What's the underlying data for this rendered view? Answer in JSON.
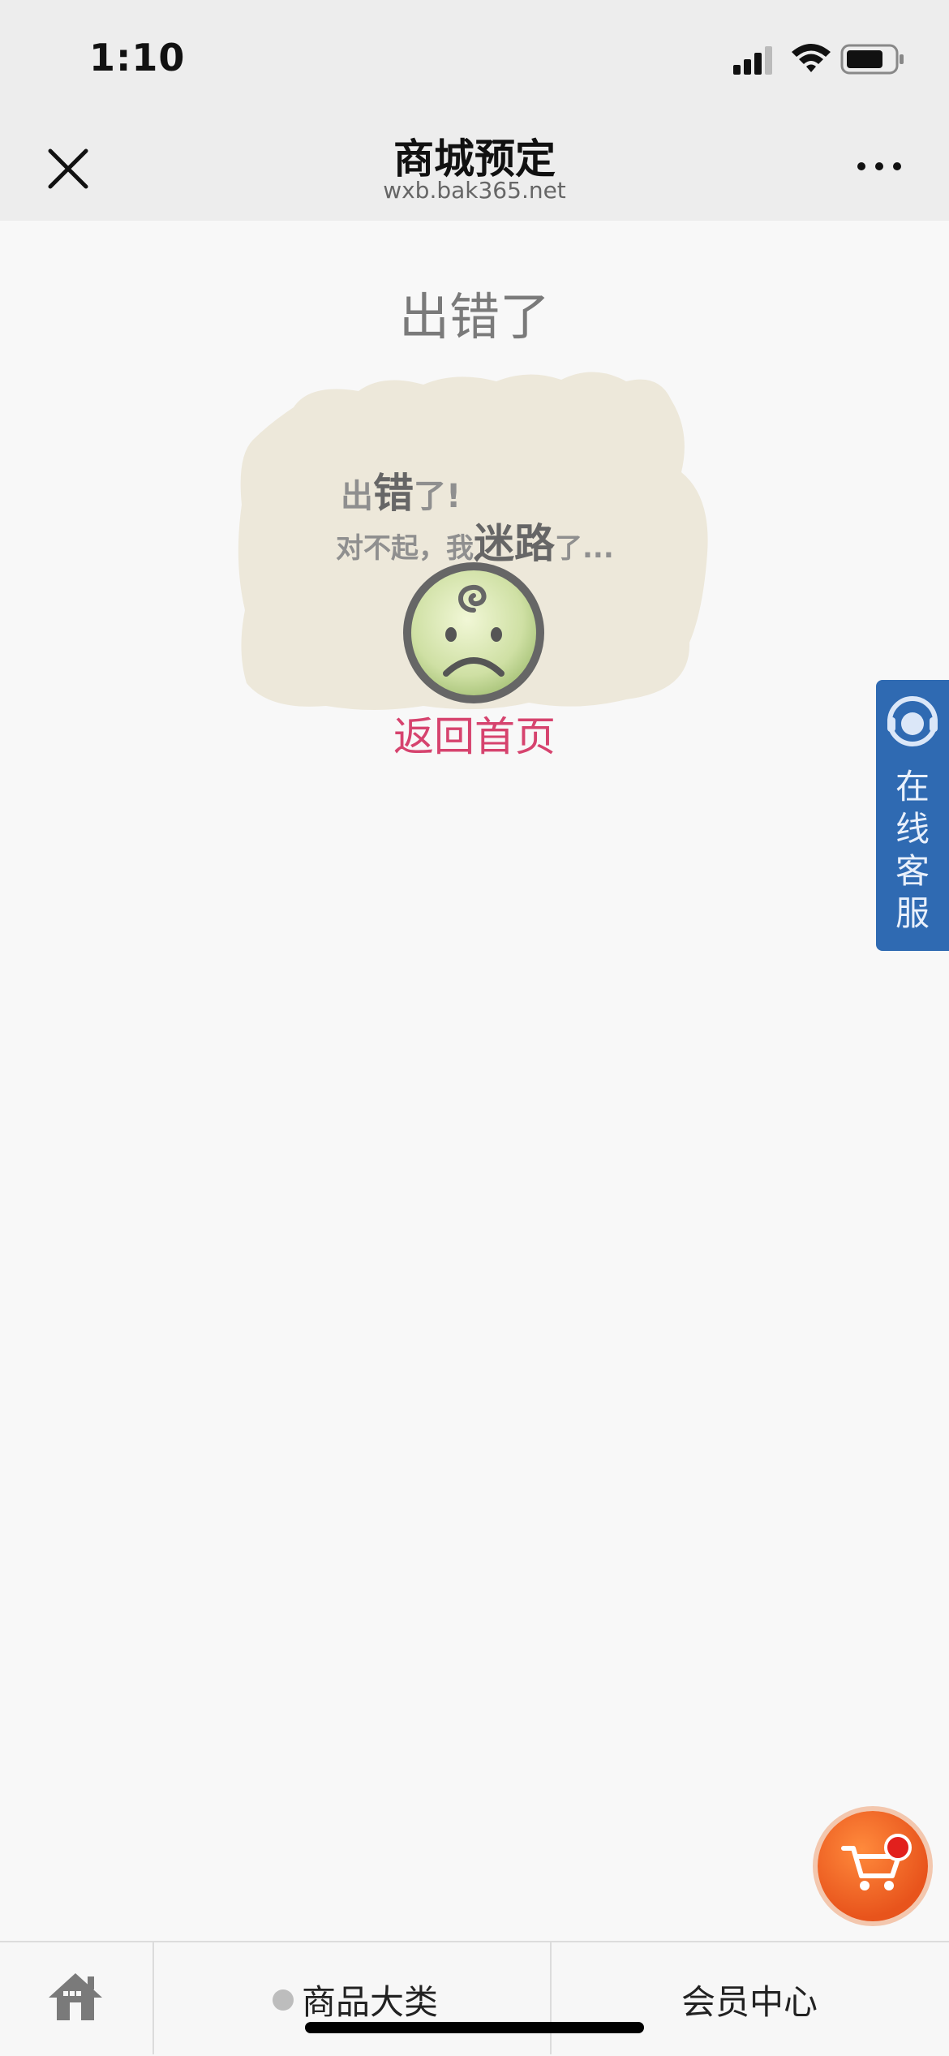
{
  "status_bar": {
    "time": "1:10"
  },
  "header": {
    "title": "商城预定",
    "url": "wxb.bak365.net"
  },
  "content": {
    "error_title": "出错了",
    "illustration": {
      "line1_small_a": "出",
      "line1_big": "错",
      "line1_small_b": "了!",
      "line2_small_a": "对不起，我",
      "line2_big": "迷路",
      "line2_small_b": "了..."
    },
    "back_home_link": "返回首页"
  },
  "side_service": {
    "label": "在线客服"
  },
  "tabbar": {
    "categories_label": "商品大类",
    "member_label": "会员中心"
  },
  "colors": {
    "header_bg": "#ededed",
    "link_pink": "#d6436e",
    "service_blue": "#2f6ab2",
    "cart_orange": "#e8541c"
  }
}
